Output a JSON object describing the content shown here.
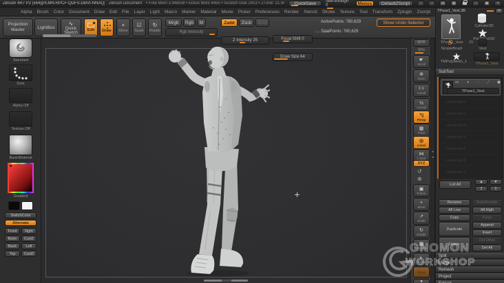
{
  "titlebar": {
    "app_title": "ZBrush 4R7 P2 (x64)[PLMN-RPCF-QDFS-DBVI-NNAQ]",
    "document_title": "ZBrush Document",
    "stats": "• Free Mem 3.948GB • Active Mem 4450 • Scratch Disk 2413 • ZTime: 21.94",
    "quicksave_label": "QuickSave",
    "see_through_label": "See-through 0",
    "menus_label": "Menus",
    "default_zscript_label": "DefaultZScript"
  },
  "menubar": {
    "items": [
      "Alpha",
      "Brush",
      "Color",
      "Document",
      "Draw",
      "Edit",
      "File",
      "Layer",
      "Light",
      "Macro",
      "Marker",
      "Material",
      "Movie",
      "Picker",
      "Preferences",
      "Render",
      "Stencil",
      "Stroke",
      "Texture",
      "Tool",
      "Transform",
      "Zplugin",
      "Zscript"
    ]
  },
  "shelf": {
    "projection_master": "Projection Master",
    "lightbox": "LightBox",
    "quick_sketch": "Quick Sketch",
    "edit": "Edit",
    "draw": "Draw",
    "move": "Move",
    "scale": "Scale",
    "rotate": "Rotate",
    "mrgb": "Mrgb",
    "rgb": "Rgb",
    "m": "M",
    "rgb_intensity": "Rgb Intensity",
    "zadd": "Zadd",
    "zsub": "Zsub",
    "zcut": "Zcut",
    "z_intensity": "Z Intensity 25",
    "focal_shift": "Focal Shift 0",
    "draw_size": "Draw Size 64",
    "dynamic": "Dynamic",
    "active_points": "ActivePoints: 780,629",
    "total_points": "TotalPoints: 780,629",
    "show_undo": "Show Undo Selector"
  },
  "left_sidebar": {
    "brush_label": "Standard",
    "stroke_label": "Dots",
    "alpha_label": "Alpha  Off",
    "texture_label": "Texture  Off",
    "material_label": "BasicMaterial",
    "gradient_label": "Gradient",
    "switchcolor_label": "SwitchColor",
    "alternate_label": "Alternate",
    "view_buttons": [
      "Front",
      "Rght",
      "Botm",
      "Cust1",
      "Back",
      "Left",
      "Top",
      "Cust2"
    ]
  },
  "right_shelf": {
    "items": [
      {
        "label": "BPR"
      },
      {
        "label": "SPix"
      },
      {
        "label": "Scroll"
      },
      {
        "label": "Zoom"
      },
      {
        "label": "Actual"
      },
      {
        "label": "AAHalf"
      },
      {
        "label": "Persp"
      },
      {
        "label": "Floor"
      },
      {
        "label": "Local"
      },
      {
        "label": "L.Sym"
      },
      {
        "label": "XYZ"
      },
      {
        "label": "Frame"
      },
      {
        "label": "Move"
      },
      {
        "label": "Scale"
      },
      {
        "label": "Rotate"
      },
      {
        "label": "PolyF"
      },
      {
        "label": "Transp"
      },
      {
        "label": "Ghost"
      },
      {
        "label": "Solo"
      }
    ]
  },
  "tool_panel": {
    "header": "TPose1_Vest.3B",
    "r_button": "R",
    "active_tool_label": "TPose1_Vest",
    "cylinder_label": "Cylinder3D",
    "polymesh_label": "PolyMesh3D",
    "simplebrush_label": "SimpleBrush",
    "simplebrush_glyph": "S",
    "count_label": "29",
    "vest_label": "Vest",
    "tmpolymesh_label": "TMPolyMesh_1",
    "recent_label": "TPose1_Vest"
  },
  "subtool": {
    "header": "SubTool",
    "active_name": "TPose1_Vest",
    "ghost_rows": [
      "Unnamed 1",
      "Unnamed 2",
      "Unnamed 3",
      "Unnamed 4",
      "Unnamed 5",
      "Unnamed 6",
      "Unnamed 7"
    ],
    "list_all": "List  All",
    "rename": "Rename",
    "autoreorder": "AutoReorder",
    "all_low": "All Low",
    "all_high": "All High",
    "copy": "Copy",
    "paste": "Paste",
    "duplicate": "Duplicate",
    "append": "Append",
    "insert": "Insert",
    "delete": "Delete",
    "del_other": "Del Other",
    "del_all": "Del All",
    "sections": [
      "Split",
      "Merge",
      "Remesh",
      "Project",
      "Extract"
    ]
  },
  "watermark": {
    "line1": "GNOMON",
    "line2": "WORKSHOP"
  },
  "glyphs": {
    "prev": "‹",
    "next": "›",
    "grid1": "▤",
    "grid2": "▦",
    "minimize": "–",
    "restore": "▣",
    "close": "×",
    "scroll": "☛",
    "zoom": "⊕",
    "actual": "1:1",
    "aahalf": "½",
    "persp": "◹",
    "floor": "▦",
    "local": "◎",
    "lsym": "⋈",
    "rot_ccw": "↺",
    "mag": "⊕",
    "frame": "▣",
    "move": "+",
    "scale": "↗",
    "rotate": "↻",
    "polyf": "▦",
    "transp": "◐",
    "solo": "●",
    "shelf_scale": "◱",
    "shelf_rotate": "↻",
    "quicksketch": "∿",
    "st_paint": "▭",
    "st_half": "◑",
    "st_circle": "○",
    "st_pen": "╱",
    "st_eye": "◉",
    "up": "▲",
    "down": "▼",
    "up2": "↥",
    "down2": "↧"
  },
  "colors": {
    "accent": "#e2832c",
    "canvas_bg": "#2f2f31",
    "panel_bg": "#2d2d2d"
  }
}
